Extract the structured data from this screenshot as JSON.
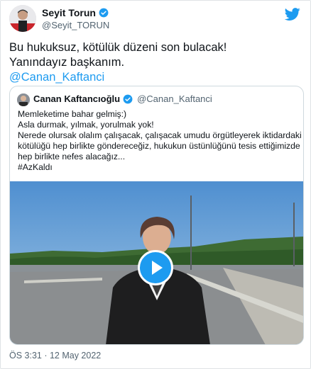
{
  "tweet": {
    "author_name": "Seyit Torun",
    "author_handle": "@Seyit_TORUN",
    "lines": [
      "Bu hukuksuz, kötülük düzeni son bulacak!",
      "Yanındayız başkanım."
    ],
    "mention": "@Canan_Kaftanci",
    "timestamp": "ÖS 3:31 · 12 May 2022"
  },
  "quoted": {
    "author_name": "Canan Kaftancıoğlu",
    "author_handle": "@Canan_Kaftanci",
    "lines": [
      "Memleketime bahar gelmiş:)",
      "Asla durmak, yılmak, yorulmak yok!",
      "Nerede olursak olalım çalışacak, çalışacak umudu örgütleyerek iktidardaki",
      "kötülüğü hep birlikte göndereceğiz, hukukun üstünlüğünü tesis ettiğimizde",
      "hep birlikte nefes alacağız..."
    ],
    "hashtag": "#AzKaldı"
  },
  "icons": {
    "verified": "verified-badge-icon",
    "brand": "twitter-bird-icon",
    "play": "play-icon"
  },
  "colors": {
    "accent": "#1d9bf0",
    "text": "#0f1419",
    "muted": "#536471",
    "border": "#cfd9de"
  }
}
